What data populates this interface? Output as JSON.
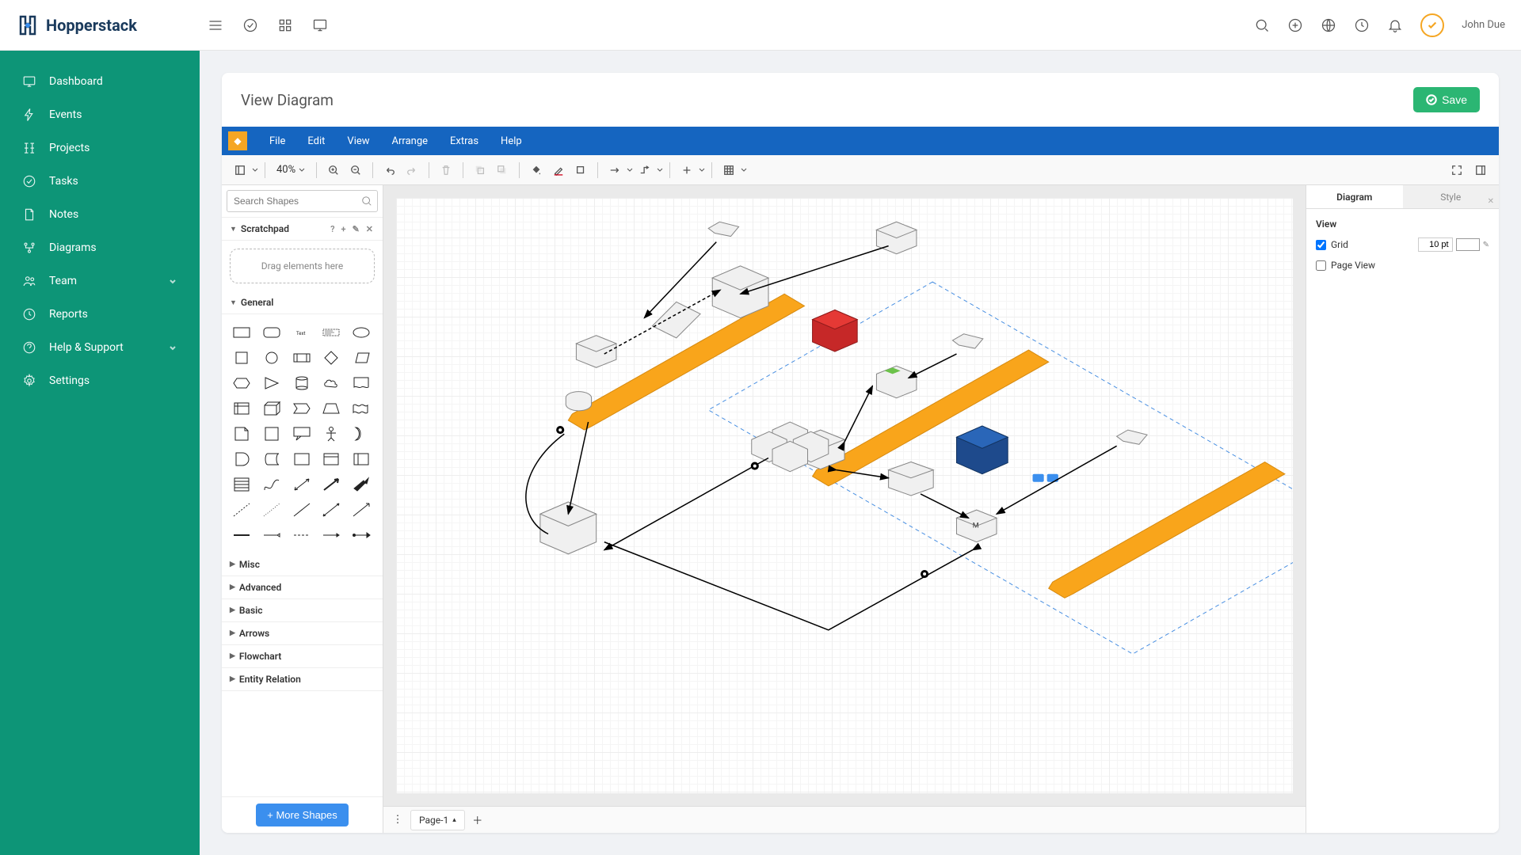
{
  "app_name": "Hopperstack",
  "user_name": "John Due",
  "sidebar": {
    "items": [
      {
        "label": "Dashboard",
        "icon": "monitor"
      },
      {
        "label": "Events",
        "icon": "lightning"
      },
      {
        "label": "Projects",
        "icon": "grid"
      },
      {
        "label": "Tasks",
        "icon": "check-circle"
      },
      {
        "label": "Notes",
        "icon": "file"
      },
      {
        "label": "Diagrams",
        "icon": "flow"
      },
      {
        "label": "Team",
        "icon": "users",
        "expandable": true
      },
      {
        "label": "Reports",
        "icon": "clock"
      },
      {
        "label": "Help & Support",
        "icon": "help",
        "expandable": true
      },
      {
        "label": "Settings",
        "icon": "gear"
      }
    ]
  },
  "page": {
    "title": "View Diagram",
    "save_label": "Save"
  },
  "menubar": [
    "File",
    "Edit",
    "View",
    "Arrange",
    "Extras",
    "Help"
  ],
  "toolbar": {
    "zoom": "40%"
  },
  "shapes_panel": {
    "search_placeholder": "Search Shapes",
    "scratchpad_title": "Scratchpad",
    "scratchpad_hint": "Drag elements here",
    "sections": {
      "general": "General",
      "misc": "Misc",
      "advanced": "Advanced",
      "basic": "Basic",
      "arrows": "Arrows",
      "flowchart": "Flowchart",
      "entity_relation": "Entity Relation"
    },
    "more_shapes": "More Shapes"
  },
  "page_tabs": {
    "pages": [
      "Page-1"
    ]
  },
  "right_panel": {
    "tab_diagram": "Diagram",
    "tab_style": "Style",
    "view_section": "View",
    "grid_label": "Grid",
    "grid_value": "10 pt",
    "grid_checked": true,
    "pageview_label": "Page View",
    "pageview_checked": false
  }
}
